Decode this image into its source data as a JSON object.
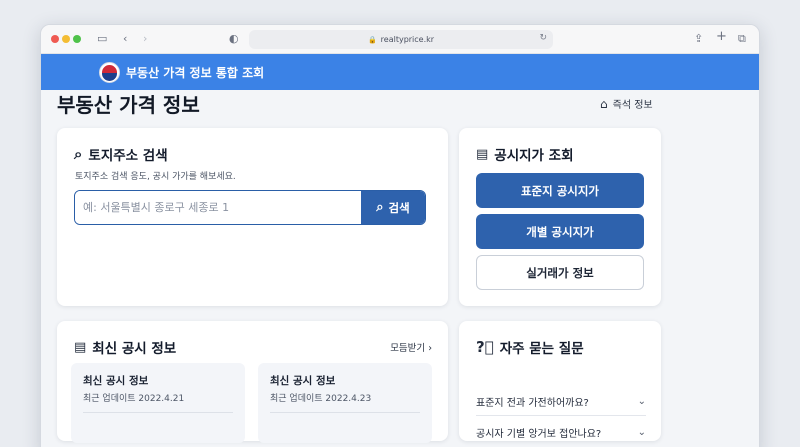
{
  "browser": {
    "url": "realtyprice.kr",
    "icons": [
      "sidebar-icon",
      "back-icon",
      "forward-icon",
      "privacy-shield-icon",
      "lock-icon",
      "reload-icon",
      "share-icon",
      "new-tab-icon",
      "tabs-overview-icon"
    ]
  },
  "header": {
    "site_title": "부동산 가격 정보 통합 조회",
    "brand_color": "#3b82e6"
  },
  "page": {
    "title": "부동산 가격 정보",
    "attrs_label": "즉석 정보"
  },
  "search": {
    "title": "토지주소 검색",
    "subtitle": "토지주소 검색 응도, 공시 가가를 해보세요.",
    "placeholder": "예: 서울특별시 종로구 세종로 1",
    "button_label": "검색"
  },
  "price": {
    "title": "공시지가 조회",
    "buttons": [
      "표준지 공시지가",
      "개별 공시지가",
      "실거래가 정보"
    ],
    "button_color": "#2e62ad"
  },
  "news": {
    "title": "최신 공시 정보",
    "more_label": "모듬받기",
    "items": [
      {
        "title": "최신 공시 정보",
        "date": "최근 업데이트 2022.4.21"
      },
      {
        "title": "최신 공시 정보",
        "date": "최근 업데이트 2022.4.23"
      }
    ]
  },
  "faq": {
    "title": "자주 묻는 질문",
    "items": [
      "표준지 전과 가전하어까요?",
      "공시자 기별 앙거보 접안나요?"
    ]
  }
}
